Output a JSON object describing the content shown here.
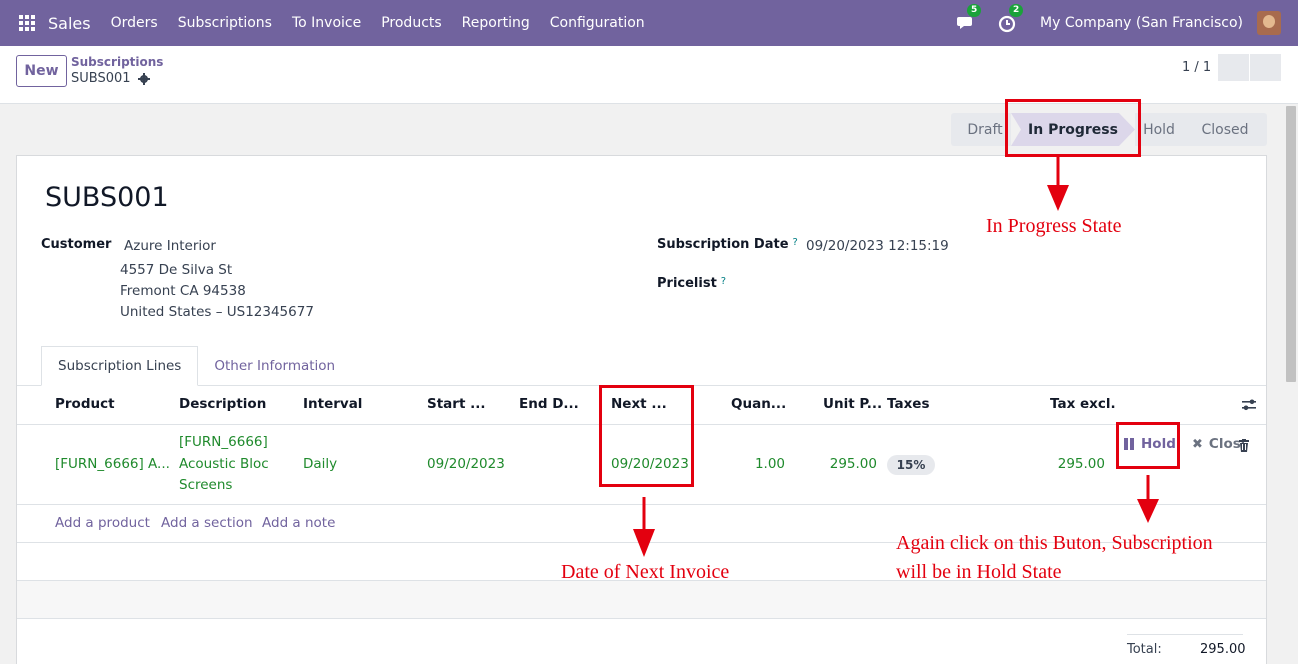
{
  "nav": {
    "brand": "Sales",
    "menu": [
      "Orders",
      "Subscriptions",
      "To Invoice",
      "Products",
      "Reporting",
      "Configuration"
    ],
    "messages_count": "5",
    "activities_count": "2",
    "company": "My Company (San Francisco)"
  },
  "control": {
    "new_label": "New",
    "breadcrumb_parent": "Subscriptions",
    "breadcrumb_current": "SUBS001",
    "pager": "1 / 1"
  },
  "statusbar": {
    "stages": [
      "Draft",
      "In Progress",
      "Hold",
      "Closed"
    ],
    "active": "In Progress"
  },
  "form": {
    "title": "SUBS001",
    "customer_label": "Customer",
    "customer_name": "Azure Interior",
    "customer_address": [
      "4557 De Silva St",
      "Fremont CA 94538",
      "United States – US12345677"
    ],
    "subscription_date_label": "Subscription Date",
    "subscription_date_help": "?",
    "subscription_date_value": "09/20/2023 12:15:19",
    "pricelist_label": "Pricelist",
    "pricelist_help": "?"
  },
  "tabs": [
    "Subscription Lines",
    "Other Information"
  ],
  "lines": {
    "headers": [
      "Product",
      "Description",
      "Interval",
      "Start ...",
      "End D...",
      "Next ...",
      "Quan...",
      "Unit P...",
      "Taxes",
      "Tax excl."
    ],
    "row": {
      "product": "[FURN_6666] A...",
      "description": [
        "[FURN_6666]",
        "Acoustic Bloc",
        "Screens"
      ],
      "interval": "Daily",
      "start": "09/20/2023",
      "end": "",
      "next": "09/20/2023",
      "quantity": "1.00",
      "unit_price": "295.00",
      "tax": "15%",
      "tax_excl": "295.00"
    },
    "actions": {
      "hold": "Hold",
      "close": "Close"
    },
    "add_links": [
      "Add a product",
      "Add a section",
      "Add a note"
    ],
    "total_label": "Total:",
    "total_value": "295.00"
  },
  "annotations": {
    "in_progress": "In Progress State",
    "next_invoice": "Date of Next Invoice",
    "hold_line1": "Again click on this Buton, Subscription",
    "hold_line2": "will be in Hold State"
  },
  "colors": {
    "nav": "#71639e",
    "accent": "#71639e",
    "green_text": "#1f8a2c",
    "annotation_red": "#e3000f"
  }
}
